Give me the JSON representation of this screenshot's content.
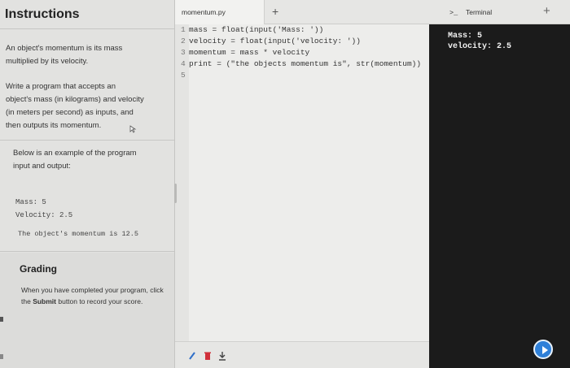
{
  "instructions": {
    "title": "Instructions",
    "para1_line1": "An object's momentum is its mass",
    "para1_line2": "multiplied by its velocity.",
    "para2_line1": "Write a program that accepts an",
    "para2_line2": "object's mass (in kilograms) and velocity",
    "para2_line3": "(in meters per second) as inputs, and",
    "para2_line4": "then outputs its momentum.",
    "para3_line1": "Below is an example of the program",
    "para3_line2": "input and output:",
    "example_line1": "Mass: 5",
    "example_line2": "Velocity: 2.5",
    "example_line3": "The object's momentum is 12.5",
    "grading_title": "Grading",
    "grading_pre": "When you have completed your program, click the ",
    "grading_bold": "Submit",
    "grading_post": " button to record your score."
  },
  "editor": {
    "tab_label": "momentum.py",
    "new_tab": "+",
    "lines": [
      {
        "num": "1",
        "text": "mass = float(input('Mass: '))"
      },
      {
        "num": "2",
        "text": "velocity = float(input('velocity: '))"
      },
      {
        "num": "3",
        "text": "momentum = mass * velocity"
      },
      {
        "num": "4",
        "text": "print = (\"the objects momentum is\", str(momentum))"
      },
      {
        "num": "5",
        "text": ""
      }
    ]
  },
  "terminal": {
    "prompt_symbol": ">_",
    "tab_label": "Terminal",
    "new_tab": "+",
    "output": [
      "Mass: 5",
      "velocity: 2.5"
    ]
  },
  "colors": {
    "terminal_bg": "#1b1b1b",
    "run_button": "#2f80d8",
    "keyword": "#c0392b"
  }
}
